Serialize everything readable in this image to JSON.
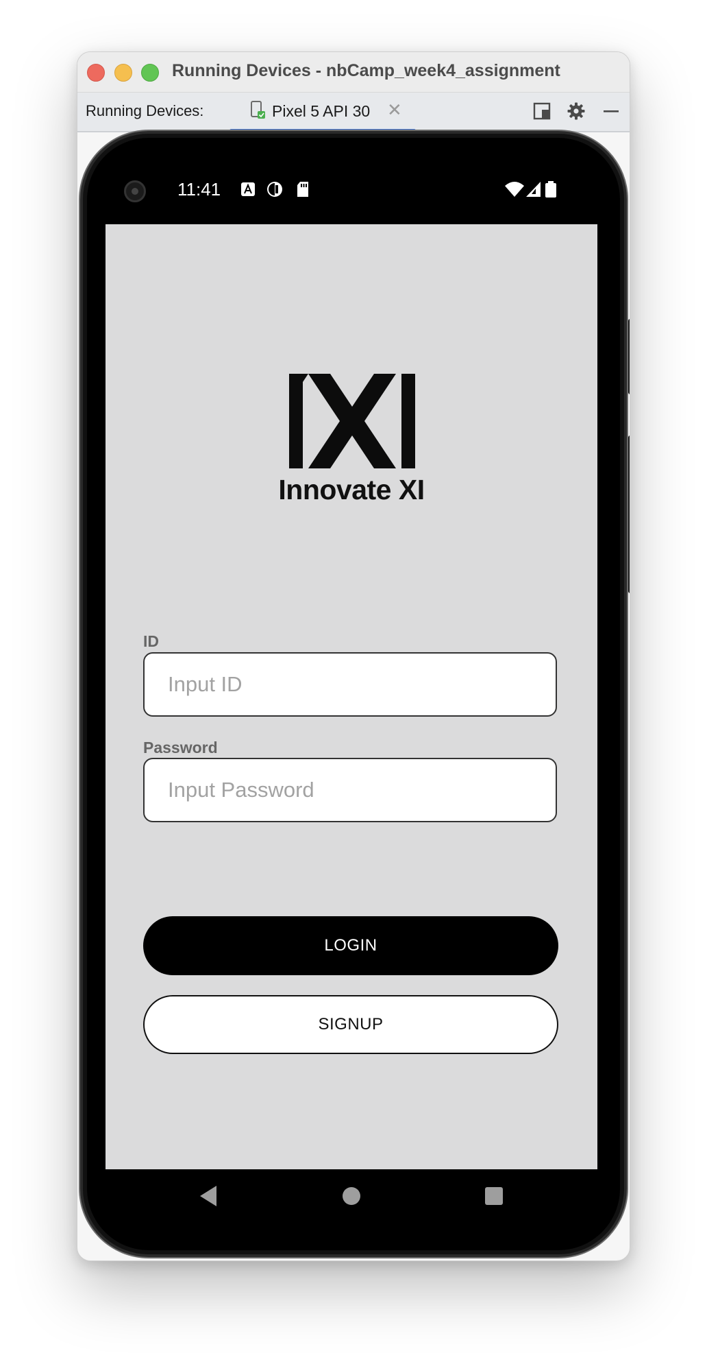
{
  "window": {
    "title": "Running Devices - nbCamp_week4_assignment",
    "traffic_lights": {
      "close": "#ed6a5e",
      "minimize": "#f5bf4f",
      "maximize": "#61c554"
    }
  },
  "toolbar": {
    "label": "Running Devices:",
    "device_tab": {
      "label": "Pixel 5 API 30",
      "close_glyph": "✕",
      "accent": "#4a7ad9"
    },
    "icons": [
      "layout-icon",
      "gear-icon",
      "minimize-icon"
    ]
  },
  "status_bar": {
    "time": "11:41",
    "icons": [
      "camera-icon",
      "font-a-icon",
      "data-saver-icon",
      "sd-card-icon",
      "wifi-icon",
      "signal-icon",
      "battery-icon"
    ]
  },
  "app": {
    "brand_name": "Innovate XI",
    "logo_icon": "innovate-xi-logo",
    "id_field": {
      "label": "ID",
      "placeholder": "Input ID",
      "value": ""
    },
    "password_field": {
      "label": "Password",
      "placeholder": "Input Password",
      "value": ""
    },
    "login_button": "LOGIN",
    "signup_button": "SIGNUP",
    "background": "#dbdbdc"
  },
  "navigation_bar": {
    "icons": [
      "back-icon",
      "home-icon",
      "recents-icon"
    ]
  }
}
